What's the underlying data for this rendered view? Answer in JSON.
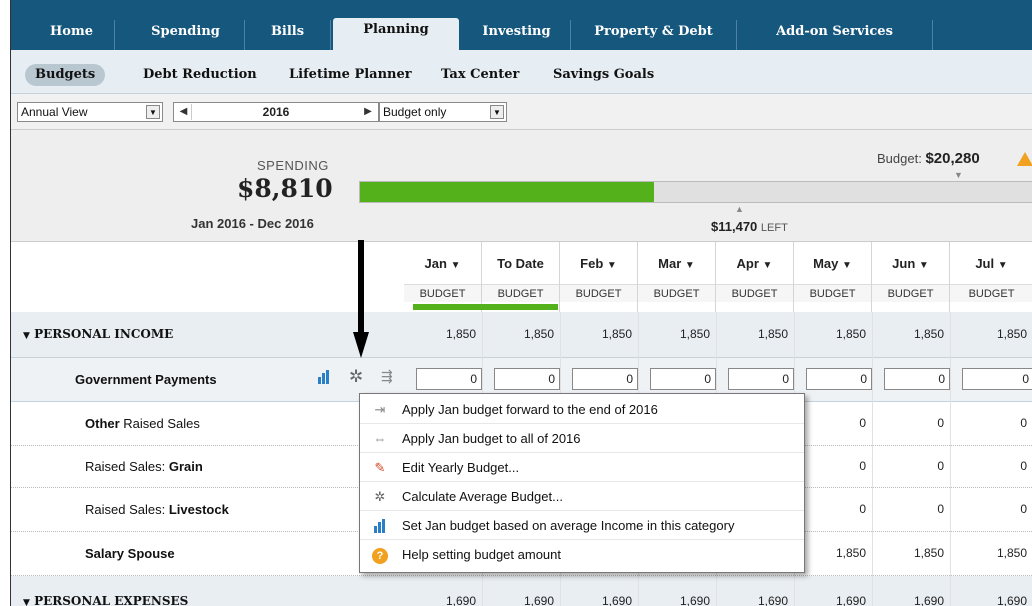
{
  "nav": {
    "tabs": [
      {
        "label": "Home"
      },
      {
        "label": "Spending"
      },
      {
        "label": "Bills"
      },
      {
        "label": "Planning"
      },
      {
        "label": "Investing"
      },
      {
        "label": "Property & Debt"
      },
      {
        "label": "Add-on Services"
      }
    ],
    "active": "Planning"
  },
  "subnav": {
    "items": [
      {
        "label": "Budgets"
      },
      {
        "label": "Debt Reduction"
      },
      {
        "label": "Lifetime Planner"
      },
      {
        "label": "Tax Center"
      },
      {
        "label": "Savings Goals"
      }
    ]
  },
  "toolbar": {
    "view": "Annual View",
    "year": "2016",
    "mode": "Budget only"
  },
  "summary": {
    "spending_label": "SPENDING",
    "spending_amount": "$8,810",
    "date_range": "Jan 2016 - Dec 2016",
    "budget_prefix": "Budget:",
    "budget_amount": "$20,280",
    "left_amount": "$11,470",
    "left_suffix": "LEFT",
    "progress_fraction": 0.434
  },
  "columns": [
    {
      "month": "Jan",
      "sub": "BUDGET"
    },
    {
      "month": "To Date",
      "sub": "BUDGET"
    },
    {
      "month": "Feb",
      "sub": "BUDGET"
    },
    {
      "month": "Mar",
      "sub": "BUDGET"
    },
    {
      "month": "Apr",
      "sub": "BUDGET"
    },
    {
      "month": "May",
      "sub": "BUDGET"
    },
    {
      "month": "Jun",
      "sub": "BUDGET"
    },
    {
      "month": "Jul",
      "sub": "BUDGET"
    }
  ],
  "rows": {
    "income": {
      "label": "PERSONAL INCOME",
      "values": [
        "1,850",
        "1,850",
        "1,850",
        "1,850",
        "1,850",
        "1,850",
        "1,850",
        "1,850"
      ]
    },
    "gov": {
      "label": "Government Payments",
      "values": [
        "0",
        "0",
        "0",
        "0",
        "0",
        "0",
        "0",
        "0"
      ]
    },
    "other": {
      "label_bold": "Other",
      "label_rest": " Raised Sales",
      "values": [
        "0",
        "0",
        "0"
      ]
    },
    "grain": {
      "label_rest": "Raised Sales: ",
      "label_bold": "Grain",
      "values": [
        "0",
        "0",
        "0"
      ]
    },
    "livestock": {
      "label_rest": "Raised Sales: ",
      "label_bold": "Livestock",
      "values": [
        "0",
        "0",
        "0"
      ]
    },
    "salary": {
      "label": "Salary Spouse",
      "values": [
        "1,850",
        "1,850",
        "1,850"
      ]
    },
    "expenses": {
      "label": "PERSONAL EXPENSES",
      "values": [
        "1,690",
        "1,690",
        "1,690",
        "1,690",
        "1,690",
        "1,690",
        "1,690",
        "1,690"
      ]
    }
  },
  "menu": {
    "items": [
      {
        "label": "Apply Jan budget forward to the end of 2016",
        "icon": "arrow-right-icon"
      },
      {
        "label": "Apply Jan budget to all of 2016",
        "icon": "arrows-horizontal-icon"
      },
      {
        "label": "Edit Yearly Budget...",
        "icon": "pencil-icon"
      },
      {
        "label": "Calculate Average Budget...",
        "icon": "gear-icon"
      },
      {
        "label": "Set Jan budget based on average Income in this category",
        "icon": "bar-chart-icon"
      },
      {
        "label": "Help setting budget amount",
        "icon": "help-icon"
      }
    ]
  },
  "colors": {
    "nav_bg": "#16577e",
    "progress": "#54b11b",
    "warning": "#f2a01f"
  }
}
